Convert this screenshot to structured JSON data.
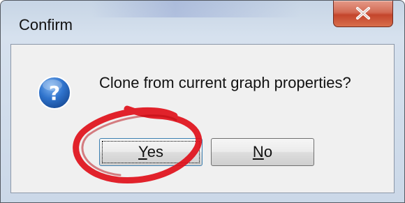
{
  "dialog": {
    "title": "Confirm",
    "message": "Clone from current graph properties?",
    "buttons": {
      "yes": {
        "mnemonic": "Y",
        "rest": "es"
      },
      "no": {
        "mnemonic": "N",
        "rest": "o"
      }
    }
  },
  "icons": {
    "close": "close-icon",
    "question": "question-icon"
  },
  "colors": {
    "close_button": "#c4452c",
    "question_icon": "#1e5fb6",
    "annotation": "#e0101a"
  }
}
